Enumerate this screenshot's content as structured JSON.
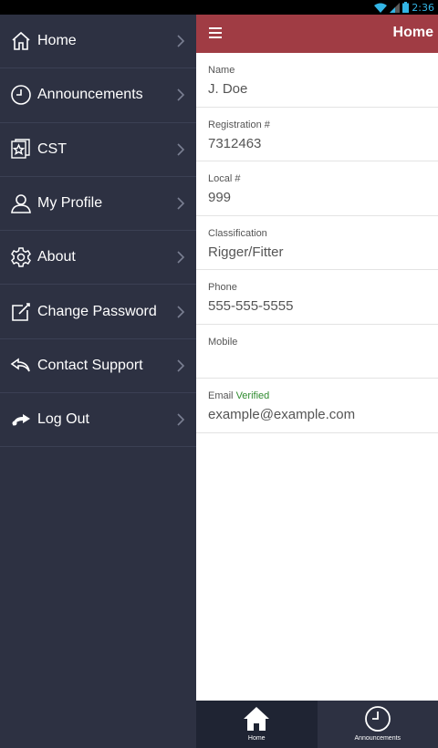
{
  "status_bar": {
    "time": "2:36",
    "icons": [
      "wifi-icon",
      "signal-icon",
      "battery-icon"
    ]
  },
  "drawer": {
    "items": [
      {
        "label": "Home",
        "icon": "home-icon"
      },
      {
        "label": "Announcements",
        "icon": "clock-icon"
      },
      {
        "label": "CST",
        "icon": "star-certificate-icon"
      },
      {
        "label": "My Profile",
        "icon": "user-icon"
      },
      {
        "label": "About",
        "icon": "gear-icon"
      },
      {
        "label": "Change Password",
        "icon": "edit-icon"
      },
      {
        "label": "Contact Support",
        "icon": "reply-icon"
      },
      {
        "label": "Log Out",
        "icon": "share-icon"
      }
    ]
  },
  "app_bar": {
    "title": "Home",
    "menu_icon": "hamburger-icon"
  },
  "profile": {
    "fields": [
      {
        "label": "Name",
        "value": "J. Doe"
      },
      {
        "label": "Registration #",
        "value": "7312463"
      },
      {
        "label": "Local #",
        "value": "999"
      },
      {
        "label": "Classification",
        "value": "Rigger/Fitter"
      },
      {
        "label": "Phone",
        "value": "555-555-5555"
      },
      {
        "label": "Mobile",
        "value": ""
      },
      {
        "label": "Email",
        "badge": "Verified",
        "value": "example@example.com"
      }
    ]
  },
  "bottom_nav": {
    "tabs": [
      {
        "label": "Home",
        "icon": "home-icon",
        "active": true
      },
      {
        "label": "Announcements",
        "icon": "clock-icon",
        "active": false
      }
    ]
  },
  "colors": {
    "drawer_bg": "#2d3142",
    "app_bar": "#a03c44",
    "verified": "#2e8b2e",
    "status_time": "#33b5e5"
  }
}
